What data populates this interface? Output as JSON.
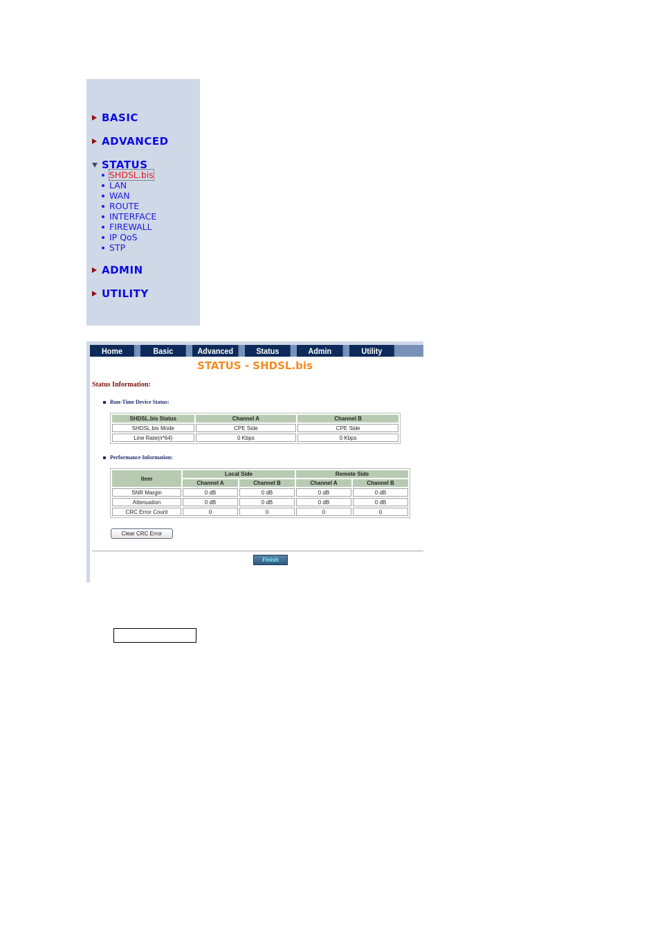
{
  "sidebar": {
    "sections": [
      {
        "label": "BASIC",
        "expanded": false
      },
      {
        "label": "ADVANCED",
        "expanded": false
      },
      {
        "label": "STATUS",
        "expanded": true
      },
      {
        "label": "ADMIN",
        "expanded": false
      },
      {
        "label": "UTILITY",
        "expanded": false
      }
    ],
    "status_items": [
      "SHDSL.bis",
      "LAN",
      "WAN",
      "ROUTE",
      "INTERFACE",
      "FIREWALL",
      "IP QoS",
      "STP"
    ],
    "active_item": "SHDSL.bis"
  },
  "nav": {
    "tabs": [
      "Home",
      "Basic",
      "Advanced",
      "Status",
      "Admin",
      "Utility"
    ]
  },
  "page": {
    "title": "STATUS - SHDSL.bis",
    "section_title": "Status Information:",
    "runtime_heading": "Run-Time Device Status:",
    "performance_heading": "Performance Information:"
  },
  "runtime_table": {
    "headers": [
      "SHDSL.bis Status",
      "Channel A",
      "Channel B"
    ],
    "rows": [
      [
        "SHDSL.bis Mode",
        "CPE Side",
        "CPE Side"
      ],
      [
        "Line Rate(n*64)",
        "0 Kbps",
        "0 Kbps"
      ]
    ]
  },
  "performance_table": {
    "item_header": "Item",
    "group_headers": [
      "Local Side",
      "Remote Side"
    ],
    "channel_headers": [
      "Channel A",
      "Channel B",
      "Channel A",
      "Channel B"
    ],
    "rows": [
      [
        "SNR Margin",
        "0 dB",
        "0 dB",
        "0 dB",
        "0 dB"
      ],
      [
        "Attenuation",
        "0 dB",
        "0 dB",
        "0 dB",
        "0 dB"
      ],
      [
        "CRC Error Count",
        "0",
        "0",
        "0",
        "0"
      ]
    ]
  },
  "buttons": {
    "clear_crc": "Clear CRC Error",
    "finish": "Finish"
  }
}
